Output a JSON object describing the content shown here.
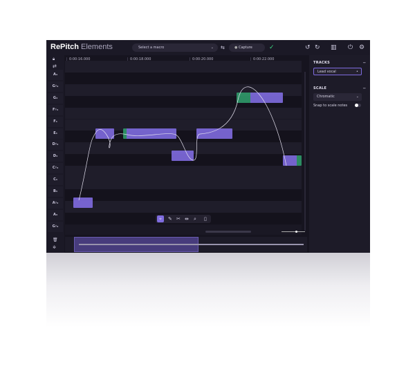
{
  "app": {
    "brand_bold": "RePitch",
    "brand_light": "Elements"
  },
  "toolbar": {
    "macro_placeholder": "Select a macro",
    "capture_label": "Capture"
  },
  "ruler": {
    "times": [
      "0:00:16.000",
      "0:00:18.000",
      "0:00:20.000",
      "0:00:22.000"
    ]
  },
  "keys": [
    "A₄",
    "G♯₄",
    "G₄",
    "F♯₄",
    "F₄",
    "E₄",
    "D♯₄",
    "D₄",
    "C♯₄",
    "C₄",
    "B₃",
    "A♯₃",
    "A₃",
    "G♯₃"
  ],
  "tracks": {
    "title": "TRACKS",
    "items": [
      "Lead vocal"
    ]
  },
  "scale": {
    "title": "SCALE",
    "selected": "Chromatic",
    "snap_label": "Snap to scale notes",
    "snap_on": false
  },
  "colors": {
    "accent": "#7f6ce0",
    "green": "#2f9a6a",
    "status": "#3ddc84"
  }
}
